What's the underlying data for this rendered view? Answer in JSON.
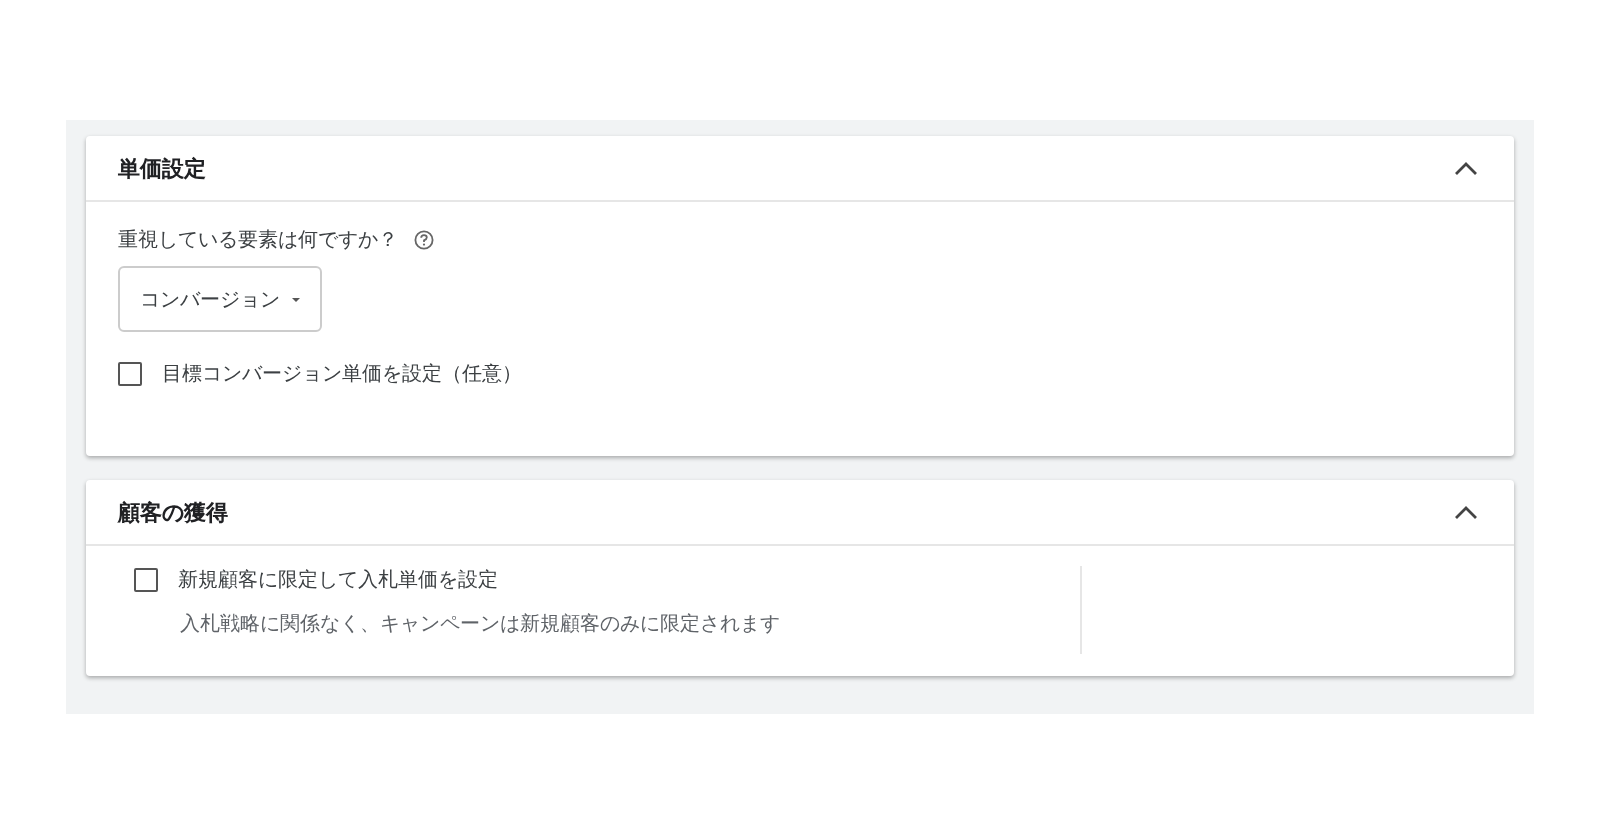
{
  "sections": [
    {
      "kind": "bidding",
      "title": "単価設定",
      "expanded": true,
      "question": "重視している要素は何ですか？",
      "dropdown": {
        "value": "コンバージョン"
      },
      "checkbox": {
        "label": "目標コンバージョン単価を設定（任意）",
        "checked": false
      }
    },
    {
      "kind": "acquisition",
      "title": "顧客の獲得",
      "expanded": true,
      "checkbox": {
        "label": "新規顧客に限定して入札単価を設定",
        "checked": false,
        "description": "入札戦略に関係なく、キャンペーンは新規顧客のみに限定されます"
      }
    }
  ]
}
